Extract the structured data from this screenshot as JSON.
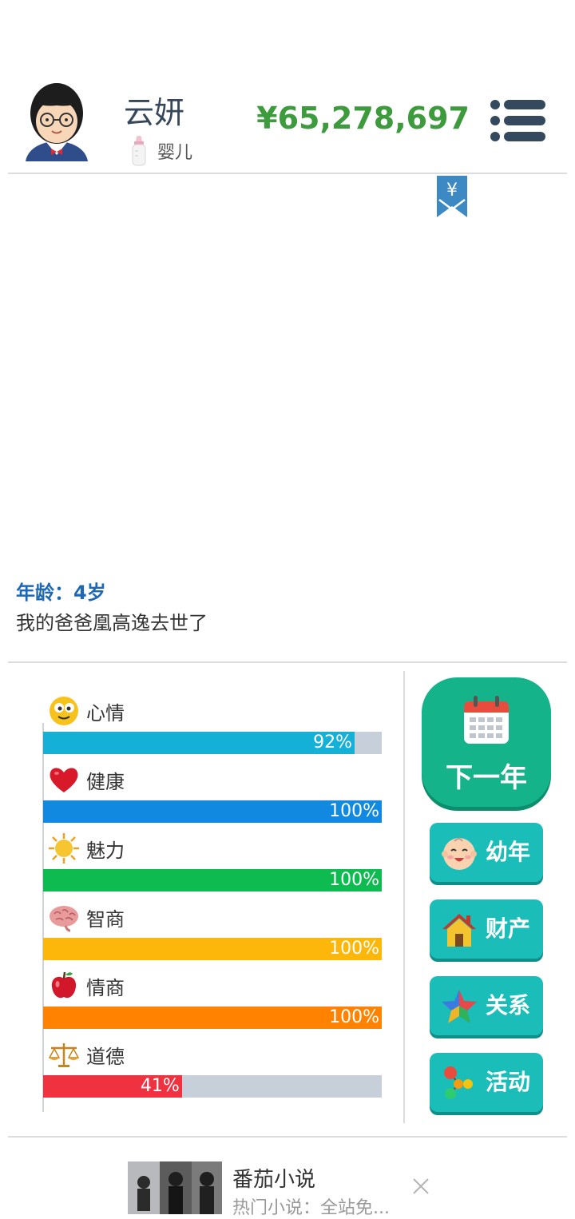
{
  "header": {
    "player_name": "云妍",
    "life_stage": "婴儿",
    "life_stage_icon": "baby-bottle-icon",
    "money": "¥65,278,697",
    "menu_icon": "list-menu-icon"
  },
  "bookmark": {
    "symbol": "¥",
    "icon": "yen-bookmark-icon"
  },
  "log": {
    "age_line": "年龄：4岁",
    "event_line": "我的爸爸凰高逸去世了"
  },
  "stats": [
    {
      "label": "心情",
      "icon": "smiley-icon",
      "value": 92,
      "value_text": "92%",
      "color": "#14b0d6"
    },
    {
      "label": "健康",
      "icon": "heart-icon",
      "value": 100,
      "value_text": "100%",
      "color": "#1289e0"
    },
    {
      "label": "魅力",
      "icon": "sun-icon",
      "value": 100,
      "value_text": "100%",
      "color": "#0dbb50"
    },
    {
      "label": "智商",
      "icon": "brain-icon",
      "value": 100,
      "value_text": "100%",
      "color": "#fdb60a"
    },
    {
      "label": "情商",
      "icon": "apple-icon",
      "value": 100,
      "value_text": "100%",
      "color": "#ff8200"
    },
    {
      "label": "道德",
      "icon": "scales-icon",
      "value": 41,
      "value_text": "41%",
      "color": "#f0313f"
    }
  ],
  "actions": {
    "next_year": {
      "label": "下一年",
      "icon": "calendar-icon"
    },
    "buttons": [
      {
        "label": "幼年",
        "icon": "baby-face-icon"
      },
      {
        "label": "财产",
        "icon": "house-icon"
      },
      {
        "label": "关系",
        "icon": "star-icon"
      },
      {
        "label": "活动",
        "icon": "molecule-icon"
      }
    ]
  },
  "ad": {
    "title": "番茄小说",
    "subtitle": "热门小说：全站免...",
    "close_icon": "close-icon"
  },
  "colors": {
    "money": "#3d9a3d",
    "age_text": "#1e69b6",
    "primary_button": "#14b38a",
    "side_button": "#1bbdb9",
    "bar_track": "#c7d0da"
  }
}
